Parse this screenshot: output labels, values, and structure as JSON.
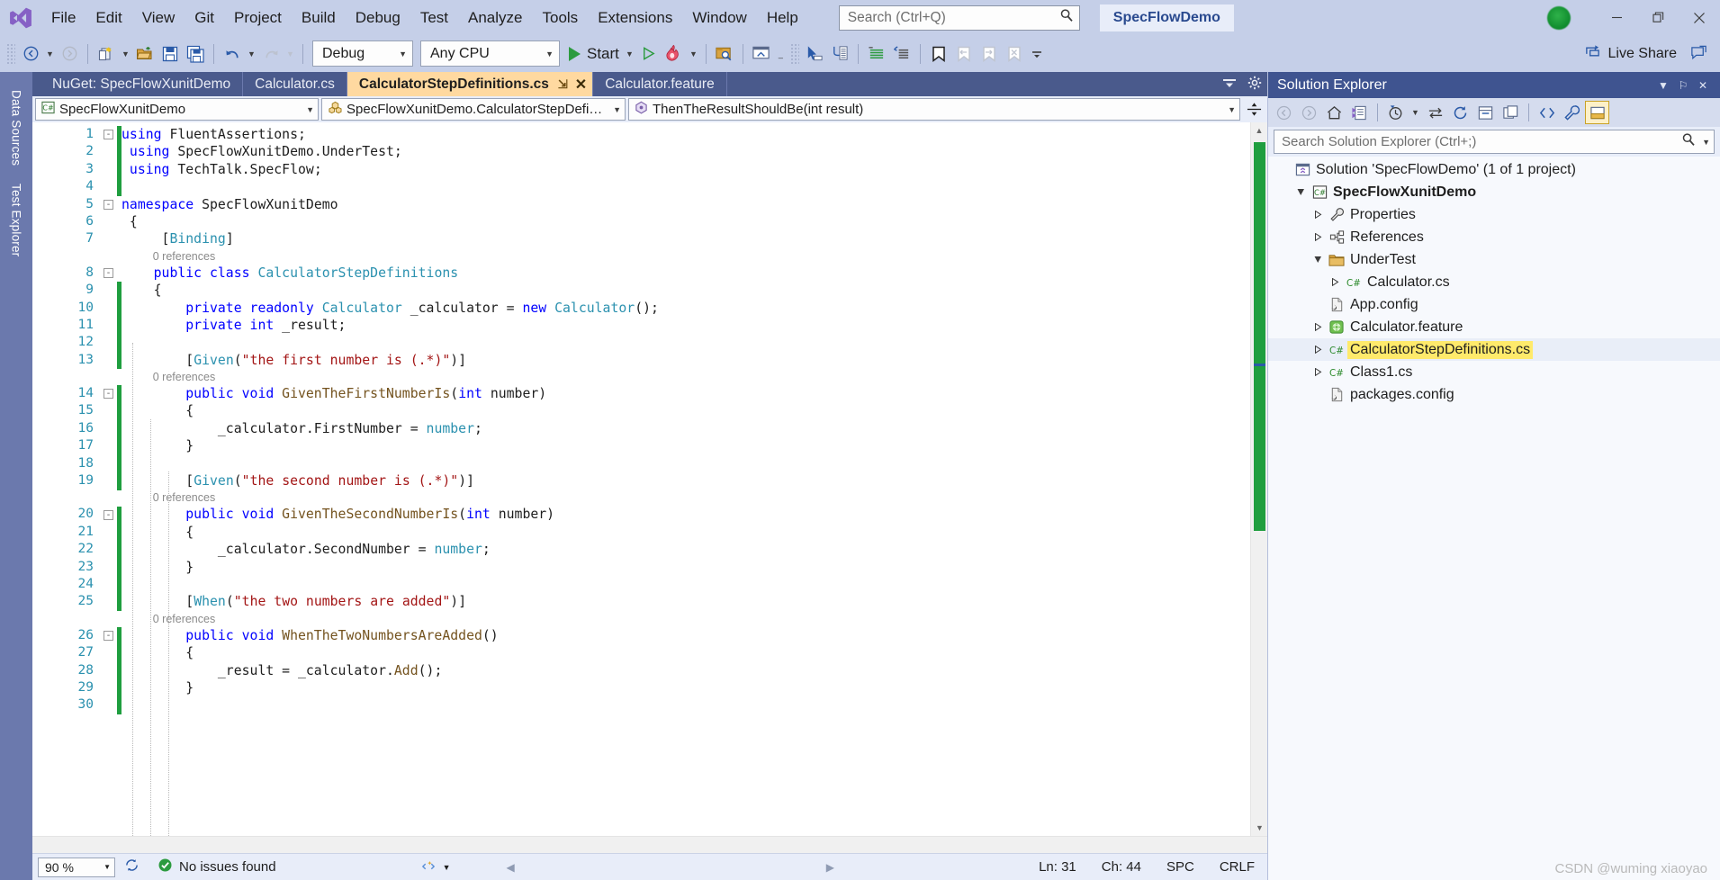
{
  "titlebar": {
    "logo": "visual-studio-logo",
    "menus": [
      "File",
      "Edit",
      "View",
      "Git",
      "Project",
      "Build",
      "Debug",
      "Test",
      "Analyze",
      "Tools",
      "Extensions",
      "Window",
      "Help"
    ],
    "search_placeholder": "Search (Ctrl+Q)",
    "search_value": "",
    "project_name": "SpecFlowDemo",
    "account_status": "signed-in",
    "window_minimize": "─",
    "window_restore": "❐",
    "window_close": "✕"
  },
  "toolbar": {
    "navigate_back": "navigate-back-icon",
    "navigate_forward": "navigate-forward-icon",
    "new_project": "new-project-icon",
    "open_file": "open-file-icon",
    "save": "save-icon",
    "save_all": "save-all-icon",
    "undo": "undo-icon",
    "redo": "redo-icon",
    "configuration": "Debug",
    "platform": "Any CPU",
    "start_label": "Start",
    "start_icon": "play-icon",
    "start_without_debug": "play-outline-icon",
    "hot_reload": "hot-reload-icon",
    "find_in_files": "find-in-files-icon",
    "toggle_window": "window-icon",
    "select_element": "pointer-icon",
    "step_into": "step-icon",
    "comment": "comment-icon",
    "uncomment": "uncomment-icon",
    "bookmark": "bookmark-icon",
    "prev_bookmark": "prev-bookmark-icon",
    "next_bookmark": "next-bookmark-icon",
    "clear_bookmarks": "clear-bookmarks-icon",
    "overflow": "toolbar-overflow-icon",
    "live_share": "Live Share",
    "live_share_icon": "live-share-icon",
    "feedback_icon": "feedback-icon"
  },
  "left_dock": {
    "tabs": [
      "Data Sources",
      "Test Explorer"
    ]
  },
  "editor": {
    "tabs": [
      {
        "label": "NuGet: SpecFlowXunitDemo",
        "active": false
      },
      {
        "label": "Calculator.cs",
        "active": false
      },
      {
        "label": "CalculatorStepDefinitions.cs",
        "active": true,
        "pin": "⇲",
        "close": "✕"
      },
      {
        "label": "Calculator.feature",
        "active": false
      }
    ],
    "tabstrip_menu_icon": "tab-list-icon",
    "tabstrip_settings_icon": "gear-icon",
    "nav": {
      "scope_icon": "csharp-project-icon",
      "scope": "SpecFlowXunitDemo",
      "type_icon": "class-icon",
      "type": "SpecFlowXunitDemo.CalculatorStepDefinitio",
      "member_icon": "method-icon",
      "member": "ThenTheResultShouldBe(int result)",
      "split_icon": "split-view-icon"
    },
    "lines": [
      {
        "n": "1",
        "fold": "minus",
        "change": true,
        "tokens": [
          [
            "k",
            "using"
          ],
          [
            "p",
            " FluentAssertions;"
          ]
        ]
      },
      {
        "n": "2",
        "change": true,
        "tokens": [
          [
            "p",
            " "
          ],
          [
            "k",
            "using"
          ],
          [
            "p",
            " SpecFlowXunitDemo.UnderTest;"
          ]
        ]
      },
      {
        "n": "3",
        "change": true,
        "tokens": [
          [
            "p",
            " "
          ],
          [
            "k",
            "using"
          ],
          [
            "p",
            " TechTalk.SpecFlow;"
          ]
        ]
      },
      {
        "n": "4",
        "change": true,
        "tokens": [
          [
            "p",
            ""
          ]
        ]
      },
      {
        "n": "5",
        "fold": "minus",
        "tokens": [
          [
            "k",
            "namespace"
          ],
          [
            "p",
            " SpecFlowXunitDemo"
          ]
        ]
      },
      {
        "n": "6",
        "tokens": [
          [
            "p",
            " {"
          ]
        ]
      },
      {
        "n": "7",
        "tokens": [
          [
            "p",
            "     ["
          ],
          [
            "t",
            "Binding"
          ],
          [
            "p",
            "]"
          ]
        ]
      },
      {
        "n": "",
        "ref": "0 references"
      },
      {
        "n": "8",
        "fold": "minus",
        "tokens": [
          [
            "k",
            "    public class"
          ],
          [
            "t",
            " CalculatorStepDefinitions"
          ]
        ]
      },
      {
        "n": "9",
        "change": true,
        "tokens": [
          [
            "p",
            "    {"
          ]
        ]
      },
      {
        "n": "10",
        "change": true,
        "tokens": [
          [
            "k",
            "        private readonly"
          ],
          [
            "t",
            " Calculator"
          ],
          [
            "p",
            " _calculator = "
          ],
          [
            "k",
            "new"
          ],
          [
            "t",
            " Calculator"
          ],
          [
            "p",
            "();"
          ]
        ]
      },
      {
        "n": "11",
        "change": true,
        "tokens": [
          [
            "k",
            "        private int"
          ],
          [
            "p",
            " _result;"
          ]
        ]
      },
      {
        "n": "12",
        "change": true,
        "tokens": [
          [
            "p",
            ""
          ]
        ]
      },
      {
        "n": "13",
        "change": true,
        "tokens": [
          [
            "p",
            "        ["
          ],
          [
            "t",
            "Given"
          ],
          [
            "p",
            "("
          ],
          [
            "s",
            "\"the first number is (.*)\""
          ],
          [
            "p",
            ")]"
          ]
        ]
      },
      {
        "n": "",
        "ref": "0 references"
      },
      {
        "n": "14",
        "fold": "minus",
        "change": true,
        "tokens": [
          [
            "k",
            "        public void"
          ],
          [
            "m",
            " GivenTheFirstNumberIs"
          ],
          [
            "p",
            "("
          ],
          [
            "k",
            "int"
          ],
          [
            "p",
            " number)"
          ]
        ]
      },
      {
        "n": "15",
        "change": true,
        "tokens": [
          [
            "p",
            "        {"
          ]
        ]
      },
      {
        "n": "16",
        "change": true,
        "tokens": [
          [
            "p",
            "            _calculator.FirstNumber = "
          ],
          [
            "g",
            "number"
          ],
          [
            "p",
            ";"
          ]
        ]
      },
      {
        "n": "17",
        "change": true,
        "tokens": [
          [
            "p",
            "        }"
          ]
        ]
      },
      {
        "n": "18",
        "change": true,
        "tokens": [
          [
            "p",
            ""
          ]
        ]
      },
      {
        "n": "19",
        "change": true,
        "tokens": [
          [
            "p",
            "        ["
          ],
          [
            "t",
            "Given"
          ],
          [
            "p",
            "("
          ],
          [
            "s",
            "\"the second number is (.*)\""
          ],
          [
            "p",
            ")]"
          ]
        ]
      },
      {
        "n": "",
        "ref": "0 references"
      },
      {
        "n": "20",
        "fold": "minus",
        "change": true,
        "tokens": [
          [
            "k",
            "        public void"
          ],
          [
            "m",
            " GivenTheSecondNumberIs"
          ],
          [
            "p",
            "("
          ],
          [
            "k",
            "int"
          ],
          [
            "p",
            " number)"
          ]
        ]
      },
      {
        "n": "21",
        "change": true,
        "tokens": [
          [
            "p",
            "        {"
          ]
        ]
      },
      {
        "n": "22",
        "change": true,
        "tokens": [
          [
            "p",
            "            _calculator.SecondNumber = "
          ],
          [
            "g",
            "number"
          ],
          [
            "p",
            ";"
          ]
        ]
      },
      {
        "n": "23",
        "change": true,
        "tokens": [
          [
            "p",
            "        }"
          ]
        ]
      },
      {
        "n": "24",
        "change": true,
        "tokens": [
          [
            "p",
            ""
          ]
        ]
      },
      {
        "n": "25",
        "change": true,
        "tokens": [
          [
            "p",
            "        ["
          ],
          [
            "t",
            "When"
          ],
          [
            "p",
            "("
          ],
          [
            "s",
            "\"the two numbers are added\""
          ],
          [
            "p",
            ")]"
          ]
        ]
      },
      {
        "n": "",
        "ref": "0 references"
      },
      {
        "n": "26",
        "fold": "minus",
        "change": true,
        "tokens": [
          [
            "k",
            "        public void"
          ],
          [
            "m",
            " WhenTheTwoNumbersAreAdded"
          ],
          [
            "p",
            "()"
          ]
        ]
      },
      {
        "n": "27",
        "change": true,
        "tokens": [
          [
            "p",
            "        {"
          ]
        ]
      },
      {
        "n": "28",
        "change": true,
        "tokens": [
          [
            "p",
            "            _result = _calculator."
          ],
          [
            "m",
            "Add"
          ],
          [
            "p",
            "();"
          ]
        ]
      },
      {
        "n": "29",
        "change": true,
        "tokens": [
          [
            "p",
            "        }"
          ]
        ]
      },
      {
        "n": "30",
        "change": true,
        "tokens": [
          [
            "p",
            ""
          ]
        ]
      }
    ]
  },
  "statusbar": {
    "zoom": "90 %",
    "zoom_caret": "▼",
    "sync_icon": "sync-icon",
    "issues_icon": "check-circle-icon",
    "issues": "No issues found",
    "intellicode_icon": "intellicode-icon",
    "intellicode_caret": "▼",
    "prev_icon": "◀",
    "next_icon": "▶",
    "line": "Ln: 31",
    "column": "Ch: 44",
    "insert_mode": "SPC",
    "line_ending": "CRLF",
    "watermark": "CSDN @wuming xiaoyao"
  },
  "solution_explorer": {
    "title": "Solution Explorer",
    "title_buttons": [
      {
        "name": "dropdown-icon",
        "glyph": "▼"
      },
      {
        "name": "pin-icon",
        "glyph": "⚐"
      },
      {
        "name": "close-icon",
        "glyph": "✕"
      }
    ],
    "toolbar": [
      {
        "name": "back-icon",
        "glyph": "←"
      },
      {
        "name": "forward-icon",
        "glyph": "→"
      },
      {
        "name": "home-icon",
        "glyph": "⌂"
      },
      {
        "name": "pending-changes-icon",
        "glyph": "▤"
      },
      {
        "name": "history-icon",
        "glyph": "◔"
      },
      {
        "name": "history-dropdown-icon",
        "glyph": "▾"
      },
      {
        "name": "sync-with-active-document-icon",
        "glyph": "⇄"
      },
      {
        "name": "refresh-icon",
        "glyph": "↻"
      },
      {
        "name": "collapse-all-icon",
        "glyph": "▣"
      },
      {
        "name": "properties-window-icon",
        "glyph": "❐"
      },
      {
        "name": "show-all-files-icon",
        "glyph": "‹›"
      },
      {
        "name": "wrench-icon",
        "glyph": "⚒"
      },
      {
        "name": "preview-selected-items-icon",
        "glyph": "▥"
      }
    ],
    "search_placeholder": "Search Solution Explorer (Ctrl+;)",
    "search_value": "",
    "tree": [
      {
        "depth": 0,
        "twist": "",
        "icon": "solution-icon",
        "label": "Solution 'SpecFlowDemo' (1 of 1 project)",
        "bold": false
      },
      {
        "depth": 1,
        "twist": "open",
        "icon": "csharp-project-icon",
        "label": "SpecFlowXunitDemo",
        "bold": true
      },
      {
        "depth": 2,
        "twist": "closed",
        "icon": "wrench-icon",
        "label": "Properties",
        "bold": false
      },
      {
        "depth": 2,
        "twist": "closed",
        "icon": "references-icon",
        "label": "References",
        "bold": false
      },
      {
        "depth": 2,
        "twist": "open",
        "icon": "folder-icon",
        "label": "UnderTest",
        "bold": false
      },
      {
        "depth": 3,
        "twist": "closed",
        "icon": "cs-file-icon",
        "label": "Calculator.cs",
        "bold": false
      },
      {
        "depth": 2,
        "twist": "",
        "icon": "config-file-icon",
        "label": "App.config",
        "bold": false
      },
      {
        "depth": 2,
        "twist": "closed",
        "icon": "feature-file-icon",
        "label": "Calculator.feature",
        "bold": false
      },
      {
        "depth": 2,
        "twist": "closed",
        "icon": "cs-file-icon",
        "label": "CalculatorStepDefinitions.cs",
        "bold": false,
        "highlight": true
      },
      {
        "depth": 2,
        "twist": "closed",
        "icon": "cs-file-icon",
        "label": "Class1.cs",
        "bold": false
      },
      {
        "depth": 2,
        "twist": "",
        "icon": "config-file-icon",
        "label": "packages.config",
        "bold": false
      }
    ]
  },
  "colors": {
    "chrome": "#c5cfe8",
    "tabstrip": "#4a5a8c",
    "active_tab": "#ffd9a0",
    "se_title": "#3f5490",
    "accent_blue": "#2a5aa8",
    "change_green": "#1f9e3f",
    "highlight_yellow": "#ffea6b"
  }
}
